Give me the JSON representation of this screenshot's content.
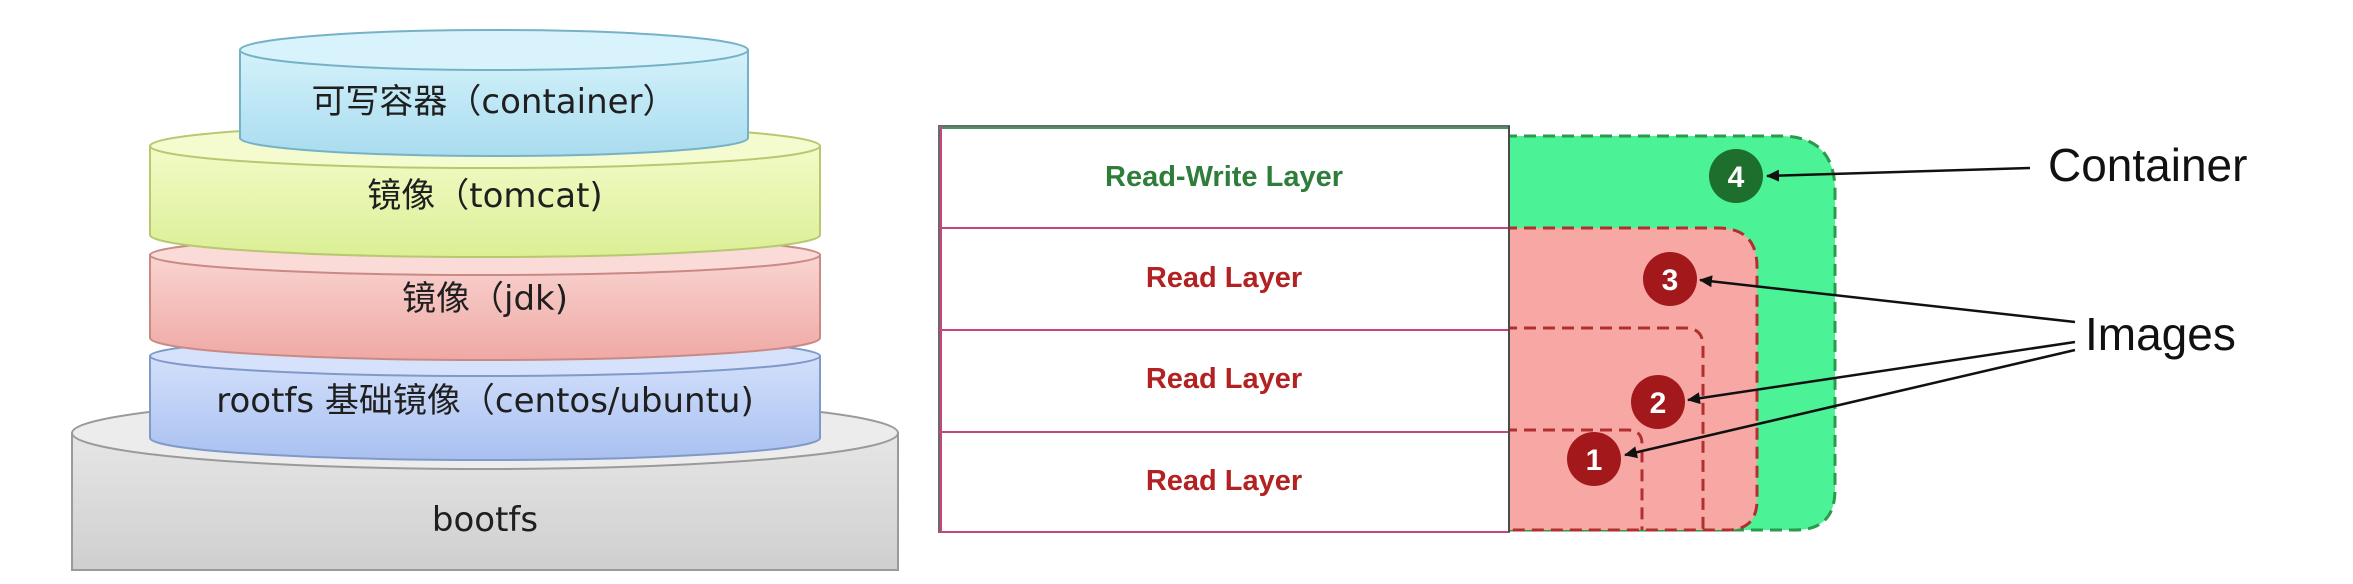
{
  "left_stack": {
    "layers": [
      {
        "label": "可写容器（container）",
        "color": "#bfe9f6"
      },
      {
        "label": "镜像（tomcat)",
        "color": "#eaf6b4"
      },
      {
        "label": "镜像（jdk)",
        "color": "#f6c7c3"
      },
      {
        "label": "rootfs 基础镜像（centos/ubuntu)",
        "color": "#c6d6f7"
      },
      {
        "label": "bootfs",
        "color": "#e2e2e2"
      }
    ]
  },
  "right_diagram": {
    "rows": [
      {
        "label": "Read-Write Layer",
        "color": "#2e7d3a"
      },
      {
        "label": "Read Layer",
        "color": "#b22222"
      },
      {
        "label": "Read Layer",
        "color": "#b22222"
      },
      {
        "label": "Read Layer",
        "color": "#b22222"
      }
    ],
    "badges": [
      "1",
      "2",
      "3",
      "4"
    ],
    "callouts": {
      "container": "Container",
      "images": "Images"
    },
    "colors": {
      "container_fill": "#4cf296",
      "container_border": "#2a9a4c",
      "image_fill": "#f8a8a4",
      "image_border": "#b03030",
      "badge_red": "#a3191b",
      "badge_green": "#1e6e2e"
    }
  }
}
